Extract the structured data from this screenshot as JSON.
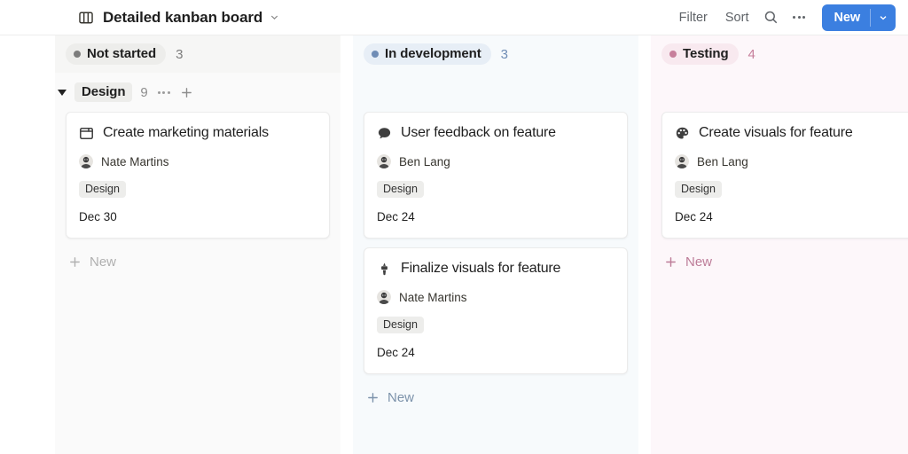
{
  "header": {
    "board_icon": "board-columns-icon",
    "title": "Detailed kanban board",
    "title_caret_icon": "chevron-down-icon",
    "filter_label": "Filter",
    "sort_label": "Sort",
    "search_icon": "search-icon",
    "more_icon": "ellipsis-icon",
    "new_label": "New",
    "new_caret_icon": "chevron-down-icon",
    "new_button_color": "#3b7fe0"
  },
  "group": {
    "collapse_icon": "triangle-down-icon",
    "label": "Design",
    "count": "9",
    "more_icon": "ellipsis-icon",
    "add_icon": "plus-icon"
  },
  "columns": [
    {
      "name": "Not started",
      "count": "3",
      "dot_color": "#7c7c7c",
      "pill_bg": "#ededeb",
      "column_bg": "#fafafa",
      "new_label": "New",
      "new_color": "#b0b0b0",
      "cards": [
        {
          "icon": "browser-window-icon",
          "title": "Create marketing materials",
          "assignee": "Nate Martins",
          "avatar": "user-avatar",
          "tag": "Design",
          "due": "Dec 30"
        }
      ]
    },
    {
      "name": "In development",
      "count": "3",
      "dot_color": "#6f8cb5",
      "pill_bg": "#e7eef6",
      "column_bg": "#f7fafc",
      "new_label": "New",
      "new_color": "#7d93ab",
      "cards": [
        {
          "icon": "speech-bubble-icon",
          "title": "User feedback on feature",
          "assignee": "Ben Lang",
          "avatar": "user-avatar",
          "tag": "Design",
          "due": "Dec 24"
        },
        {
          "icon": "paintbrush-icon",
          "title": "Finalize visuals for feature",
          "assignee": "Nate Martins",
          "avatar": "user-avatar",
          "tag": "Design",
          "due": "Dec 24"
        }
      ]
    },
    {
      "name": "Testing",
      "count": "4",
      "dot_color": "#c77f9b",
      "pill_bg": "#f8e9ef",
      "column_bg": "#fdf7fa",
      "new_label": "New",
      "new_color": "#bd7c98",
      "cards": [
        {
          "icon": "palette-icon",
          "title": "Create visuals for feature",
          "assignee": "Ben Lang",
          "avatar": "user-avatar",
          "tag": "Design",
          "due": "Dec 24"
        }
      ]
    }
  ]
}
